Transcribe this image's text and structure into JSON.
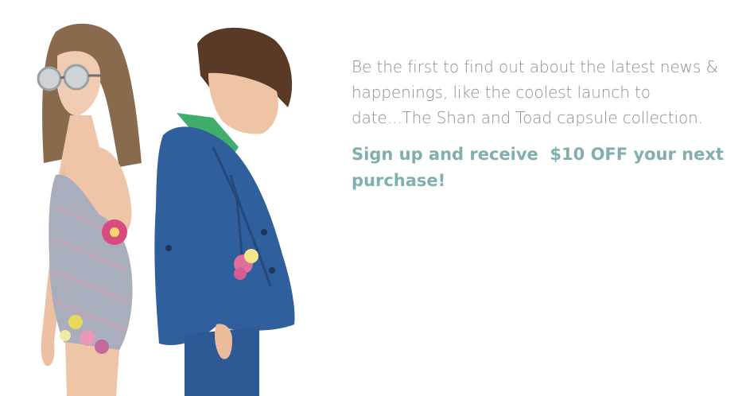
{
  "popup": {
    "intro_text": "Be the first to find out about the latest news & happenings, like the coolest launch to date...The Shan and Toad capsule collection.",
    "offer_text": "Sign up and receive  $10 OFF your next purchase!",
    "colors": {
      "intro": "#8e8e8e",
      "offer": "#7fb0ae",
      "background": "#ffffff"
    }
  },
  "hero": {
    "icon": "photo-two-children"
  }
}
